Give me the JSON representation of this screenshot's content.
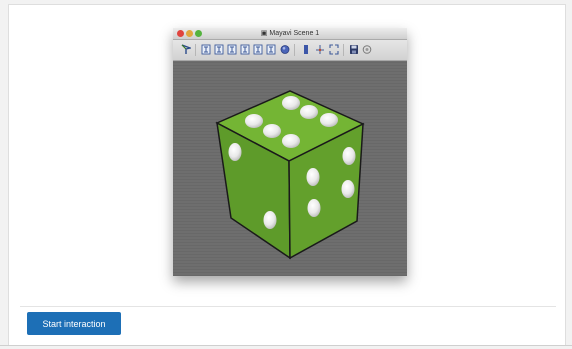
{
  "window": {
    "title": "Mayavi Scene 1"
  },
  "toolbar": {
    "buttons": [
      "mayavi-logo-icon",
      "view-x-plus-icon",
      "view-x-minus-icon",
      "view-y-plus-icon",
      "view-y-minus-icon",
      "view-z-plus-icon",
      "view-z-minus-icon",
      "isometric-view-icon",
      "parallel-projection-icon",
      "axes-toggle-icon",
      "fullscreen-icon",
      "save-icon",
      "settings-icon"
    ]
  },
  "colors": {
    "accent": "#1d6fb6",
    "die_face_light": "#72b335",
    "die_face_mid": "#5c9a28",
    "die_face_dark": "#4a8420",
    "pip": "#f2f2f2"
  },
  "controls": {
    "start_label": "Start interaction"
  }
}
